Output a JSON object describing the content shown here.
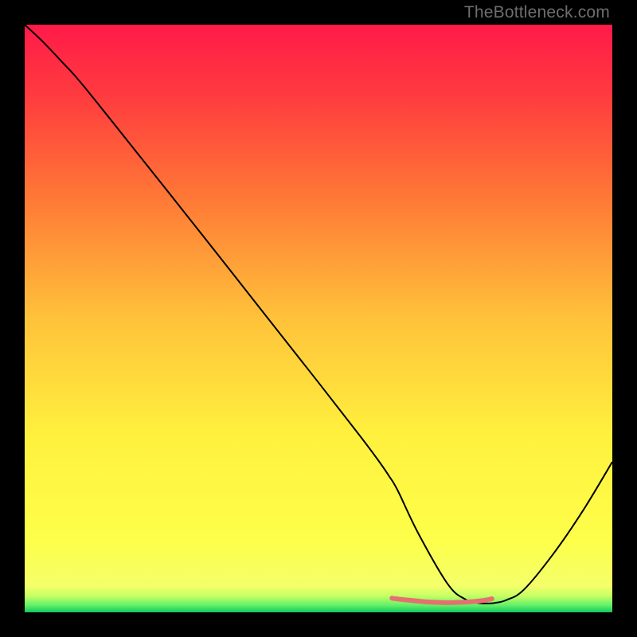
{
  "watermark": "TheBottleneck.com",
  "chart_data": {
    "type": "line",
    "title": "",
    "xlabel": "",
    "ylabel": "",
    "xlim": [
      0,
      100
    ],
    "ylim": [
      0,
      100
    ],
    "background_gradient": {
      "stops": [
        {
          "offset": 0.0,
          "color": "#ff1a49"
        },
        {
          "offset": 0.12,
          "color": "#ff3b3f"
        },
        {
          "offset": 0.3,
          "color": "#ff7a36"
        },
        {
          "offset": 0.5,
          "color": "#ffc23a"
        },
        {
          "offset": 0.7,
          "color": "#fff13e"
        },
        {
          "offset": 0.88,
          "color": "#fdff4a"
        },
        {
          "offset": 0.955,
          "color": "#f4ff6a"
        },
        {
          "offset": 0.972,
          "color": "#c7ff64"
        },
        {
          "offset": 0.988,
          "color": "#63f06a"
        },
        {
          "offset": 1.0,
          "color": "#12c95e"
        }
      ]
    },
    "series": [
      {
        "name": "curve",
        "color": "#000000",
        "x": [
          0.0,
          3.0,
          6.5,
          10.0,
          20.0,
          30.0,
          40.0,
          50.0,
          57.0,
          60.0,
          62.0,
          63.5,
          67.0,
          72.0,
          75.0,
          77.0,
          78.5,
          80.0,
          82.0,
          85.0,
          90.0,
          95.0,
          100.0
        ],
        "y": [
          100.0,
          97.2,
          93.5,
          89.6,
          77.1,
          64.5,
          51.8,
          39.1,
          30.1,
          26.1,
          23.2,
          20.7,
          13.4,
          4.8,
          2.2,
          1.6,
          1.5,
          1.6,
          2.1,
          3.9,
          10.0,
          17.3,
          25.6
        ]
      },
      {
        "name": "highlight-band",
        "color": "#e4716f",
        "thickness": 6,
        "x": [
          62.5,
          64.0,
          66.0,
          68.0,
          70.0,
          72.0,
          74.0,
          76.0,
          78.0,
          79.5
        ],
        "y": [
          2.4,
          2.2,
          2.0,
          1.8,
          1.7,
          1.65,
          1.7,
          1.8,
          2.0,
          2.3
        ]
      }
    ]
  }
}
